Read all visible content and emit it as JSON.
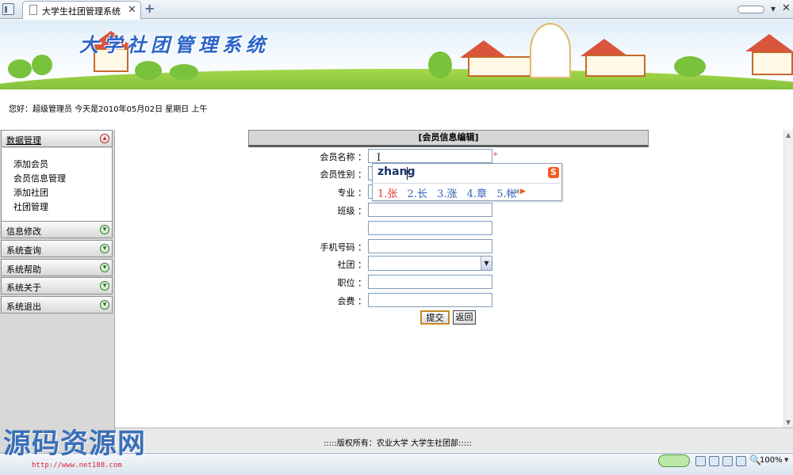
{
  "browser": {
    "tab_title": "大学生社团管理系统",
    "tab_close": "✕",
    "new_tab": "+",
    "minimize": "▾",
    "close": "✕"
  },
  "banner": {
    "title": "大学社团管理系统"
  },
  "greeting": "您好：超级管理员   今天是2010年05月02日   星期日   上午",
  "sidebar": {
    "sections": [
      {
        "label": "数据管理",
        "expanded": true,
        "icon": "collapse-icon"
      },
      {
        "label": "信息修改",
        "expanded": false,
        "icon": "expand-icon"
      },
      {
        "label": "系统查询",
        "expanded": false,
        "icon": "expand-icon"
      },
      {
        "label": "系统帮助",
        "expanded": false,
        "icon": "expand-icon"
      },
      {
        "label": "系统关于",
        "expanded": false,
        "icon": "expand-icon"
      },
      {
        "label": "系统退出",
        "expanded": false,
        "icon": "expand-icon"
      }
    ],
    "sub_items": [
      "添加会员",
      "会员信息管理",
      "添加社团",
      "社团管理"
    ]
  },
  "form": {
    "header": "[会员信息编辑]",
    "labels": {
      "name": "会员名称 ：",
      "gender": "会员性别 ：",
      "major": "专业 ：",
      "class": "班级 ：",
      "phone": "手机号码 ：",
      "club": "社团 ：",
      "position": "职位 ：",
      "fee": "会费 ："
    },
    "values": {
      "name": "",
      "gender": "",
      "major": "",
      "class": "",
      "extra": "",
      "phone": "",
      "club": "",
      "position": "",
      "fee": ""
    },
    "required_mark": "*",
    "submit_label": "提交",
    "back_label": "返回"
  },
  "ime": {
    "input": "zhang",
    "logo": "S",
    "candidates": [
      "1.张",
      "2.长",
      "3.涨",
      "4.章",
      "5.帐"
    ],
    "prev": "◀",
    "next": "▶"
  },
  "footer": {
    "copyright": ":::::版权所有：农业大学 大学生社团部:::::"
  },
  "watermark": {
    "text": "源码资源网",
    "url": "http://www.net188.com"
  },
  "statusbar": {
    "zoom": "100%"
  },
  "colors": {
    "menu_expand_icon": "#2c6a2c",
    "menu_collapse_icon": "#a33",
    "required": "#e33",
    "ime_highlight": "#e03a2c",
    "ime_candidates": "#3463b5",
    "banner_title": "#2b63c9",
    "watermark": "#3a6fb8"
  }
}
